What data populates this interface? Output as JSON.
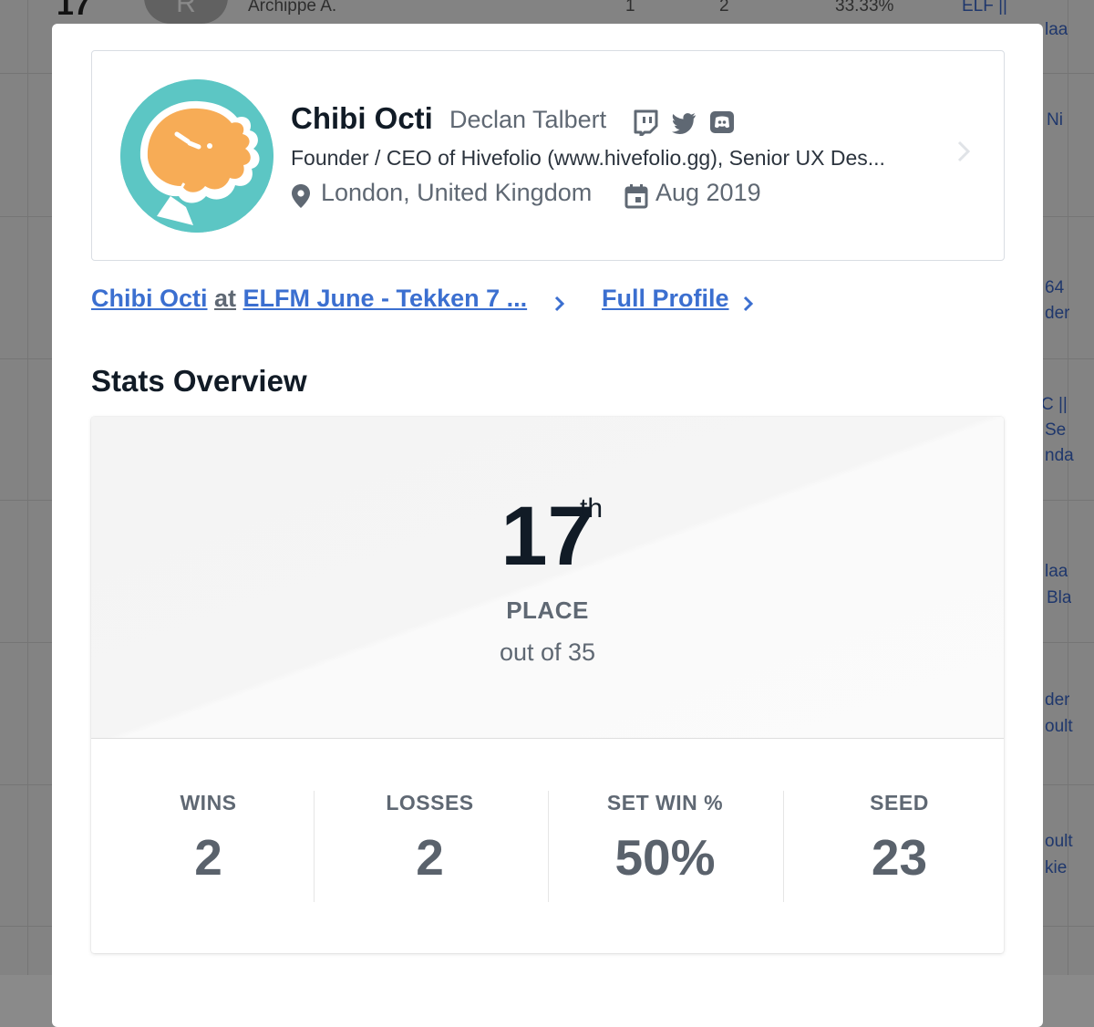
{
  "background": {
    "row_rank": "17",
    "row_avatar_letter": "R",
    "row_name": "Archippe A.",
    "row_wins": "1",
    "row_losses": "2",
    "row_pct": "33.33%",
    "right_links": [
      "ELF ||",
      "laa",
      "Ni",
      "64",
      "der",
      "C ||",
      "Se",
      "nda",
      "laa",
      "Bla",
      "der",
      "oult",
      "oult",
      "kie"
    ]
  },
  "profile": {
    "gamer_tag": "Chibi Octi",
    "real_name": "Declan Talbert",
    "bio": "Founder / CEO of Hivefolio (www.hivefolio.gg), Senior UX Des...",
    "location": "London, United Kingdom",
    "joined": "Aug 2019",
    "social_icons": [
      "twitch-icon",
      "twitter-icon",
      "discord-icon"
    ],
    "avatar_color": "#5cc6c4",
    "avatar_octopus_color": "#f7ac56"
  },
  "links": {
    "player_name": "Chibi Octi",
    "at": "at",
    "event": "ELFM June - Tekken 7 ...",
    "full_profile": "Full Profile",
    "link_color": "#3b6fd0"
  },
  "stats": {
    "title": "Stats Overview",
    "place": "17",
    "place_suffix": "th",
    "place_label": "PLACE",
    "out_of": "out of 35",
    "items": [
      {
        "label": "WINS",
        "value": "2"
      },
      {
        "label": "LOSSES",
        "value": "2"
      },
      {
        "label": "SET WIN %",
        "value": "50%"
      },
      {
        "label": "SEED",
        "value": "23"
      }
    ]
  }
}
